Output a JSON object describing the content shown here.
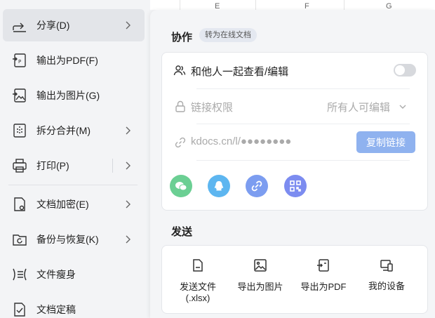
{
  "menu": {
    "items": [
      {
        "label": "分享(D)",
        "icon": "share-icon"
      },
      {
        "label": "输出为PDF(F)",
        "icon": "pdf-export-icon"
      },
      {
        "label": "输出为图片(G)",
        "icon": "image-export-icon"
      },
      {
        "label": "拆分合并(M)",
        "icon": "split-merge-icon"
      },
      {
        "label": "打印(P)",
        "icon": "printer-icon"
      },
      {
        "label": "文档加密(E)",
        "icon": "lock-doc-icon"
      },
      {
        "label": "备份与恢复(K)",
        "icon": "backup-icon"
      },
      {
        "label": "文件瘦身",
        "icon": "compress-icon"
      },
      {
        "label": "文档定稿",
        "icon": "finalize-icon"
      }
    ]
  },
  "sheet": {
    "columns": [
      "E",
      "F",
      "G"
    ]
  },
  "panel": {
    "collab_title": "协作",
    "convert_tag": "转为在线文档",
    "collab_view_label": "和他人一起查看/编辑",
    "link_permission_label": "链接权限",
    "link_permission_value": "所有人可编辑",
    "link_url": "kdocs.cn/l/●●●●●●●●",
    "copy_link_label": "复制链接",
    "send_title": "发送",
    "send_items": [
      {
        "label": "发送文件",
        "sub": "(.xlsx)",
        "icon": "file-icon"
      },
      {
        "label": "导出为图片",
        "sub": "",
        "icon": "image-icon"
      },
      {
        "label": "导出为PDF",
        "sub": "",
        "icon": "pdf-icon"
      },
      {
        "label": "我的设备",
        "sub": "",
        "icon": "devices-icon"
      }
    ],
    "share_targets": [
      {
        "name": "wechat",
        "color": "#6bcf93"
      },
      {
        "name": "qq",
        "color": "#5db6f0"
      },
      {
        "name": "link",
        "color": "#7c9df0"
      },
      {
        "name": "qrcode",
        "color": "#7c8cf0"
      }
    ]
  }
}
